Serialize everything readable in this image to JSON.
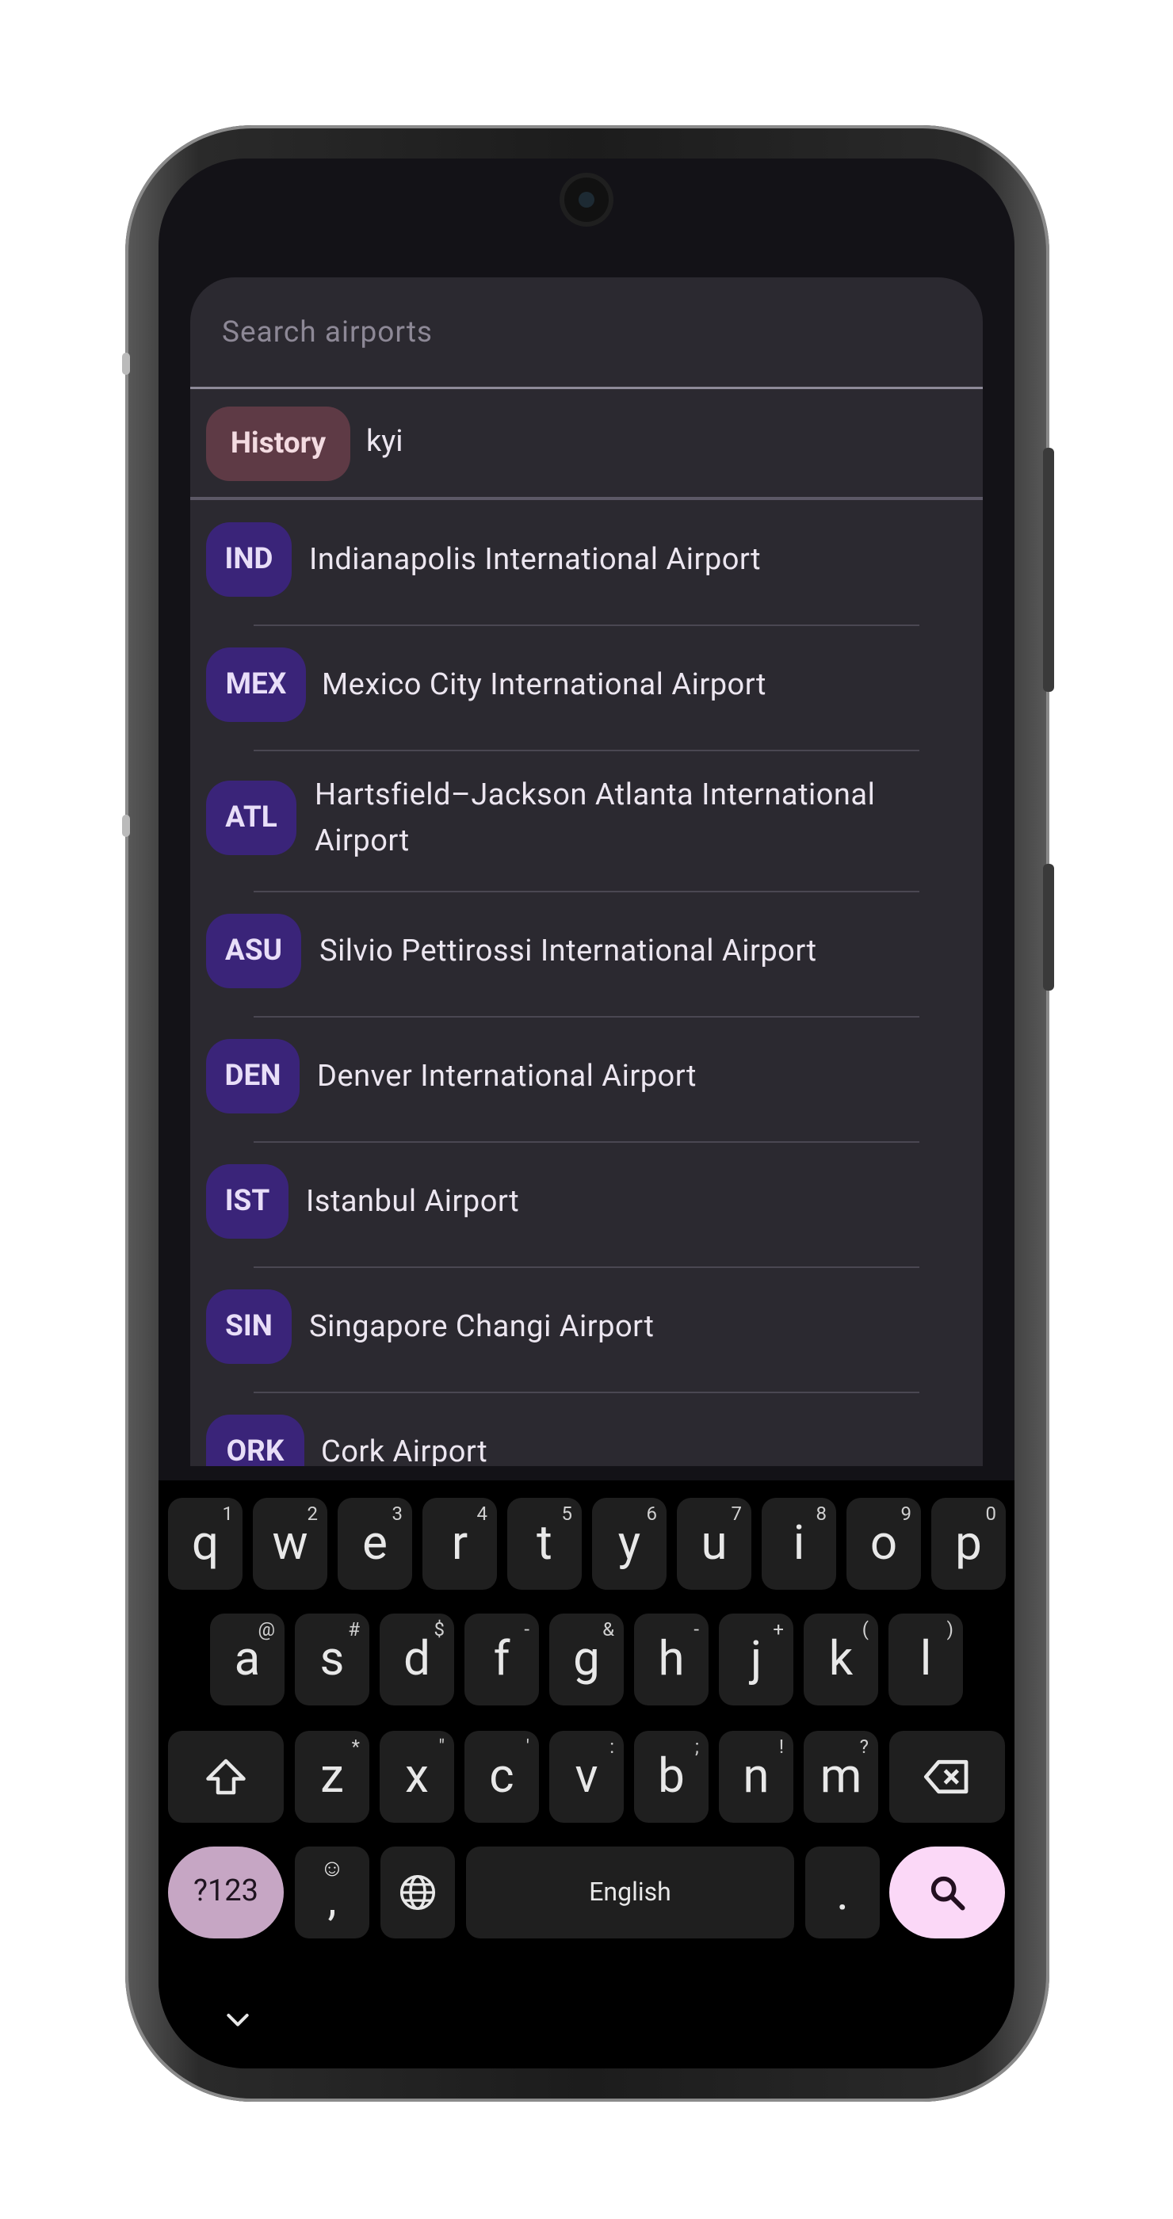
{
  "search": {
    "placeholder": "Search airports"
  },
  "history": {
    "chip_label": "History",
    "query": "kyi"
  },
  "results": [
    {
      "code": "IND",
      "name_lines": [
        "Indianapolis International Airport"
      ]
    },
    {
      "code": "MEX",
      "name_lines": [
        "Mexico City International Airport"
      ]
    },
    {
      "code": "ATL",
      "name_lines": [
        "Hartsfield–Jackson Atlanta International",
        "Airport"
      ]
    },
    {
      "code": "ASU",
      "name_lines": [
        "Silvio Pettirossi International Airport"
      ]
    },
    {
      "code": "DEN",
      "name_lines": [
        "Denver International Airport"
      ]
    },
    {
      "code": "IST",
      "name_lines": [
        "Istanbul Airport"
      ]
    },
    {
      "code": "SIN",
      "name_lines": [
        "Singapore Changi Airport"
      ]
    },
    {
      "code": "ORK",
      "name_lines": [
        "Cork Airport"
      ]
    }
  ],
  "keyboard": {
    "row1": [
      [
        "q",
        "1"
      ],
      [
        "w",
        "2"
      ],
      [
        "e",
        "3"
      ],
      [
        "r",
        "4"
      ],
      [
        "t",
        "5"
      ],
      [
        "y",
        "6"
      ],
      [
        "u",
        "7"
      ],
      [
        "i",
        "8"
      ],
      [
        "o",
        "9"
      ],
      [
        "p",
        "0"
      ]
    ],
    "row2": [
      [
        "a",
        "@"
      ],
      [
        "s",
        "#"
      ],
      [
        "d",
        "$"
      ],
      [
        "f",
        "-"
      ],
      [
        "g",
        "&"
      ],
      [
        "h",
        "-"
      ],
      [
        "j",
        "+"
      ],
      [
        "k",
        "("
      ],
      [
        "l",
        ")"
      ]
    ],
    "row3": [
      [
        "z",
        "*"
      ],
      [
        "x",
        "\""
      ],
      [
        "c",
        "'"
      ],
      [
        "v",
        ":"
      ],
      [
        "b",
        ";"
      ],
      [
        "n",
        "!"
      ],
      [
        "m",
        "?"
      ]
    ],
    "symbols_label": "?123",
    "comma_label": ",",
    "space_label": "English",
    "period_label": "."
  },
  "colors": {
    "chip_history": "#5e3a45",
    "chip_code": "#3a2479",
    "search_key": "#fbd8f7",
    "symbols_key": "#c6a6c4"
  }
}
